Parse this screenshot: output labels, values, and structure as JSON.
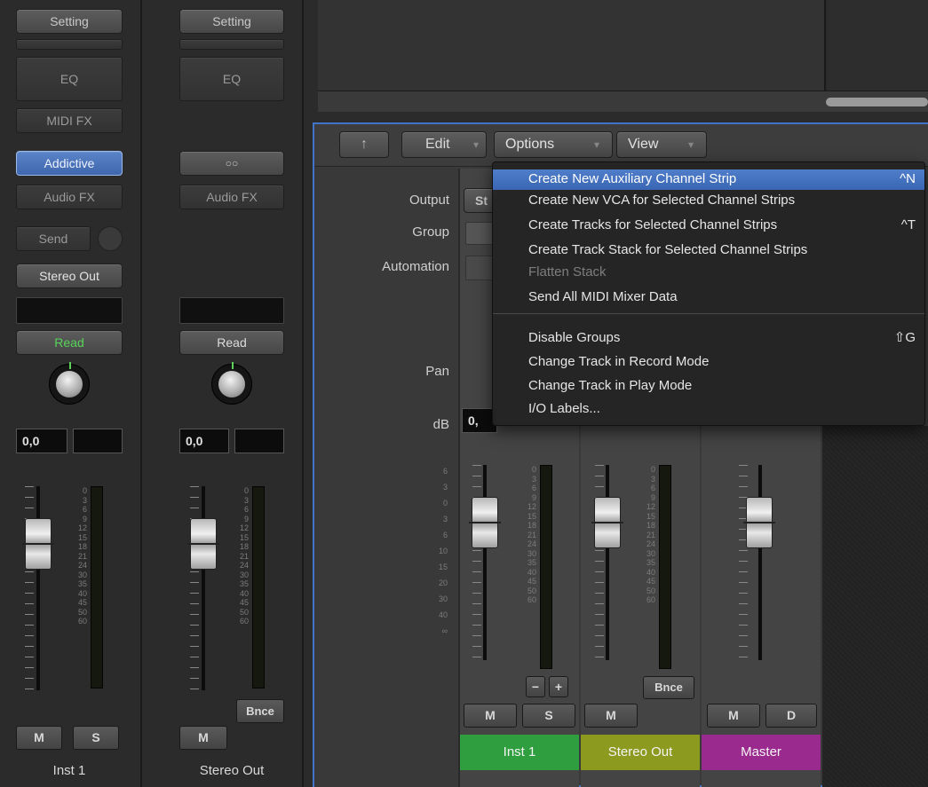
{
  "strip1": {
    "setting": "Setting",
    "eq": "EQ",
    "midi_fx": "MIDI FX",
    "instrument": "Addictive",
    "audio_fx": "Audio FX",
    "send": "Send",
    "output": "Stereo Out",
    "automation": "Read",
    "pan_value": "0,0",
    "mute": "M",
    "solo": "S",
    "name": "Inst 1"
  },
  "strip2": {
    "setting": "Setting",
    "eq": "EQ",
    "link_symbol": "○○",
    "audio_fx": "Audio FX",
    "automation": "Read",
    "pan_value": "0,0",
    "bounce": "Bnce",
    "mute": "M",
    "name": "Stereo Out"
  },
  "meter_scale": [
    "0",
    "3",
    "6",
    "9",
    "12",
    "15",
    "18",
    "21",
    "24",
    "30",
    "35",
    "40",
    "45",
    "50",
    "60"
  ],
  "fader_scale": [
    "6",
    "3",
    "0",
    "3",
    "6",
    "10",
    "15",
    "20",
    "30",
    "40",
    "∞"
  ],
  "panel": {
    "toolbar": {
      "up_icon": "↑",
      "edit": "Edit",
      "options": "Options",
      "view": "View",
      "arrow": "▾"
    },
    "labels": {
      "output": "Output",
      "group": "Group",
      "automation": "Automation",
      "pan": "Pan",
      "db": "dB"
    },
    "output_value_partial": "St",
    "db_value_partial": "0,"
  },
  "menu": [
    {
      "label": "Create New Auxiliary Channel Strip",
      "shortcut": "^N",
      "highlight": true
    },
    {
      "label": "Create New VCA for Selected Channel Strips",
      "shortcut": ""
    },
    {
      "label": "Create Tracks for Selected Channel Strips",
      "shortcut": "^T"
    },
    {
      "label": "Create Track Stack for Selected Channel Strips",
      "shortcut": ""
    },
    {
      "label": "Flatten Stack",
      "shortcut": "",
      "disabled": true
    },
    {
      "label": "Send All MIDI Mixer Data",
      "shortcut": ""
    },
    {
      "label": "Disable Groups",
      "shortcut": "⇧G"
    },
    {
      "label": "Change Track in Record Mode",
      "shortcut": ""
    },
    {
      "label": "Change Track in Play Mode",
      "shortcut": ""
    },
    {
      "label": "I/O Labels...",
      "shortcut": ""
    }
  ],
  "mini_strips": [
    {
      "mute": "M",
      "solo": "S",
      "minus": "−",
      "plus": "+",
      "name": "Inst 1",
      "color": "#2f9e3e"
    },
    {
      "mute": "M",
      "bounce": "Bnce",
      "name": "Stereo Out",
      "color": "#8c9a20"
    },
    {
      "mute": "M",
      "dim": "D",
      "name": "Master",
      "color": "#9b2a8f"
    }
  ]
}
